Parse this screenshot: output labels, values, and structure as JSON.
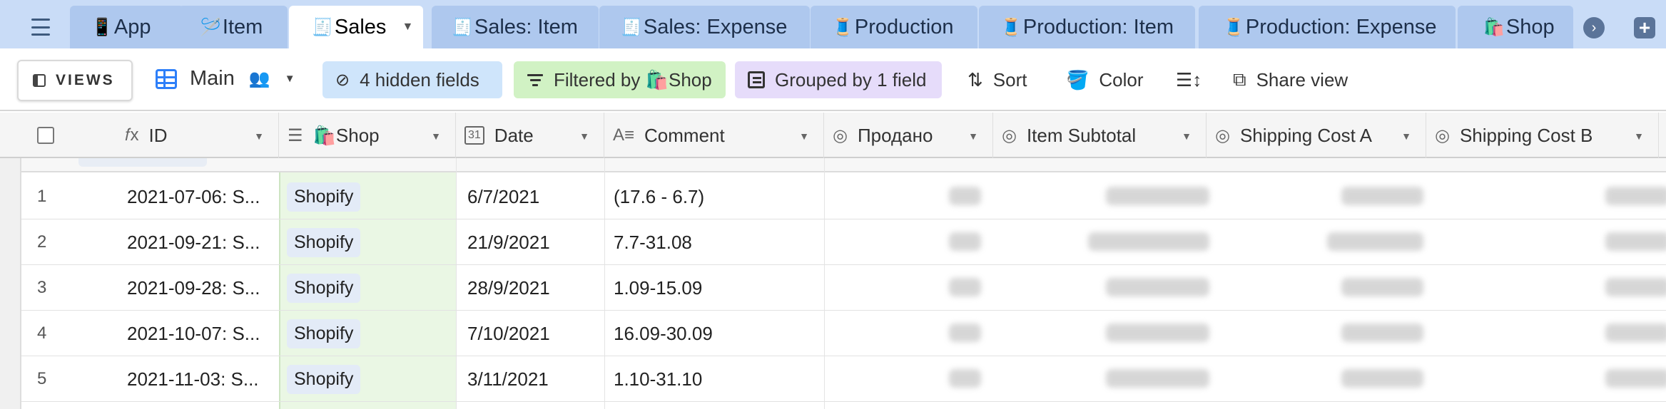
{
  "tabs": [
    {
      "icon": "📱",
      "label": "App",
      "active": false
    },
    {
      "icon": "🪡",
      "label": "Item",
      "active": false
    },
    {
      "icon": "🧾",
      "label": "Sales",
      "active": true
    },
    {
      "icon": "🧾",
      "label": "Sales: Item",
      "active": false
    },
    {
      "icon": "🧾",
      "label": "Sales: Expense",
      "active": false
    },
    {
      "icon": "🧵",
      "label": "Production",
      "active": false
    },
    {
      "icon": "🧵",
      "label": "Production: Item",
      "active": false
    },
    {
      "icon": "🧵",
      "label": "Production: Expense",
      "active": false
    },
    {
      "icon": "🛍️",
      "label": "Shop",
      "active": false
    }
  ],
  "toolbar": {
    "views_label": "VIEWS",
    "view_name": "Main",
    "hidden_fields": "4 hidden fields",
    "filtered_by": "Filtered by 🛍️Shop",
    "grouped_by": "Grouped by 1 field",
    "sort": "Sort",
    "color": "Color",
    "share_view": "Share view"
  },
  "columns": [
    {
      "name": "ID",
      "icon": "𝑓x"
    },
    {
      "name": "🛍️Shop",
      "icon": "☰"
    },
    {
      "name": "Date",
      "icon": "31"
    },
    {
      "name": "Comment",
      "icon": "A≡"
    },
    {
      "name": "Продано",
      "icon": "◎"
    },
    {
      "name": "Item Subtotal",
      "icon": "◎"
    },
    {
      "name": "Shipping Cost A",
      "icon": "◎"
    },
    {
      "name": "Shipping Cost B",
      "icon": "◎"
    }
  ],
  "rows": [
    {
      "num": "1",
      "id": "2021-07-06: S...",
      "shop": "Shopify",
      "date": "6/7/2021",
      "comment": "(17.6 - 6.7)"
    },
    {
      "num": "2",
      "id": "2021-09-21: S...",
      "shop": "Shopify",
      "date": "21/9/2021",
      "comment": "7.7-31.08"
    },
    {
      "num": "3",
      "id": "2021-09-28: S...",
      "shop": "Shopify",
      "date": "28/9/2021",
      "comment": "1.09-15.09"
    },
    {
      "num": "4",
      "id": "2021-10-07: S...",
      "shop": "Shopify",
      "date": "7/10/2021",
      "comment": "16.09-30.09"
    },
    {
      "num": "5",
      "id": "2021-11-03: S...",
      "shop": "Shopify",
      "date": "3/11/2021",
      "comment": "1.10-31.10"
    }
  ],
  "colors": {
    "tabbar": "#c9dcf7",
    "tab": "#aec8ee",
    "accent": "#2d7ff9",
    "hidden_pill": "#cfe5fb",
    "filter_pill": "#d1f2c4",
    "group_pill": "#e6dcfa",
    "shop_column": "#eaf7e4"
  }
}
